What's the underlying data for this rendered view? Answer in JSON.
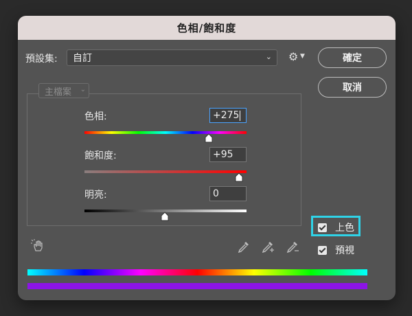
{
  "dialog": {
    "title": "色相/飽和度"
  },
  "preset": {
    "label": "預設集:",
    "value": "自訂"
  },
  "buttons": {
    "ok": "確定",
    "cancel": "取消"
  },
  "channel": {
    "value": "主檔案"
  },
  "sliders": {
    "hue": {
      "label": "色相:",
      "value": "+275",
      "min": -180,
      "max": 180
    },
    "saturation": {
      "label": "飽和度:",
      "value": "+95",
      "min": -100,
      "max": 100
    },
    "lightness": {
      "label": "明亮:",
      "value": "0",
      "min": -100,
      "max": 100
    }
  },
  "checkboxes": {
    "colorize": {
      "label": "上色",
      "checked": true
    },
    "preview": {
      "label": "預視",
      "checked": true
    }
  },
  "icons": {
    "gear": "gear-icon",
    "hand": "targeted-adjustment-hand-icon",
    "eyedropper": "eyedropper-icon",
    "eyedropper_plus": "eyedropper-plus-icon",
    "eyedropper_minus": "eyedropper-minus-icon"
  },
  "colors": {
    "accent_focus": "#2fd3e8",
    "colorize_bar": "#8c14e6"
  }
}
